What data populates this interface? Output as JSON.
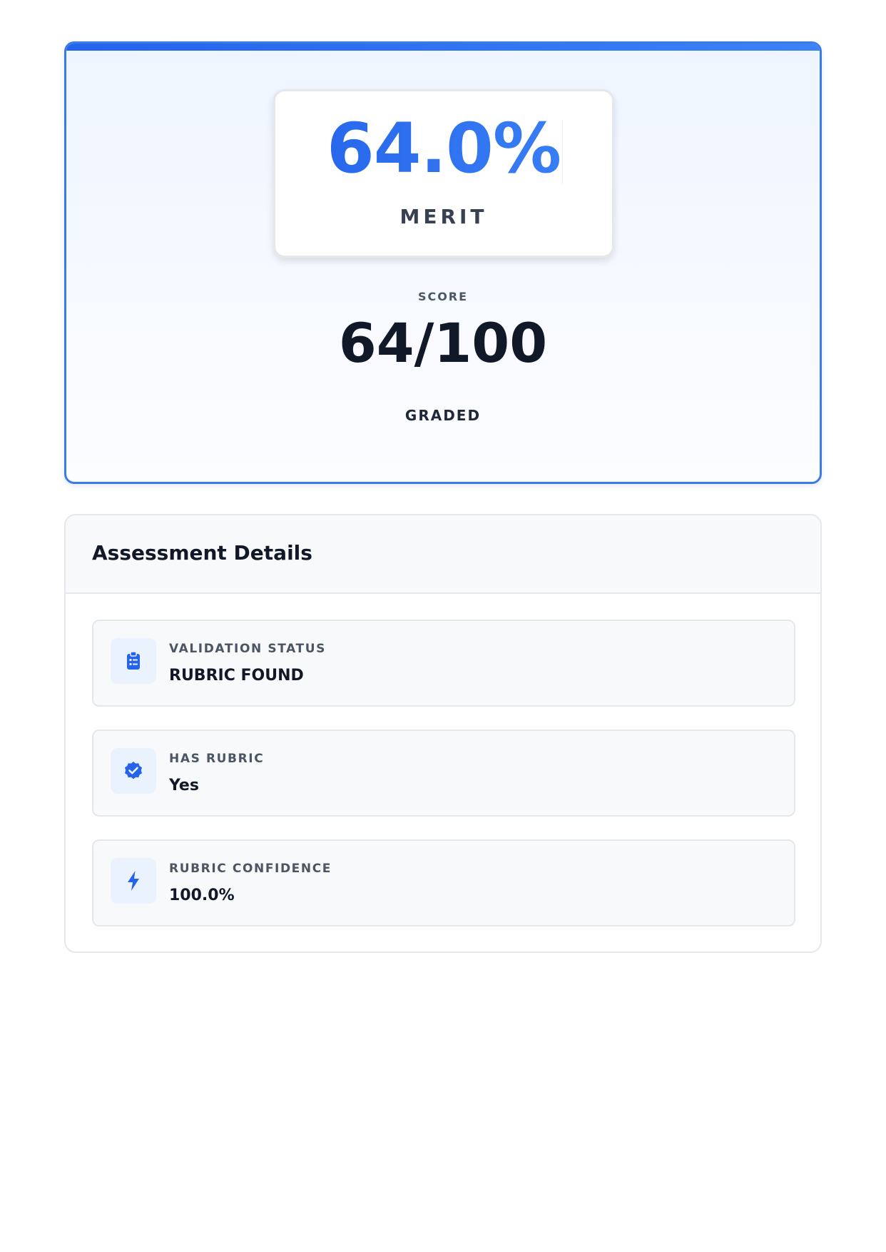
{
  "result": {
    "percentage": "64.0%",
    "grade": "MERIT",
    "score_label": "SCORE",
    "score": "64/100",
    "status": "GRADED"
  },
  "details": {
    "title": "Assessment Details",
    "items": [
      {
        "icon": "clipboard-list-icon",
        "label": "VALIDATION STATUS",
        "value": "RUBRIC FOUND"
      },
      {
        "icon": "badge-check-icon",
        "label": "HAS RUBRIC",
        "value": "Yes"
      },
      {
        "icon": "lightning-bolt-icon",
        "label": "RUBRIC CONFIDENCE",
        "value": "100.0%"
      }
    ]
  },
  "colors": {
    "accent": "#2563eb",
    "accent_light": "#3b82f6",
    "text_dark": "#111827",
    "text_muted": "#4b5563"
  }
}
